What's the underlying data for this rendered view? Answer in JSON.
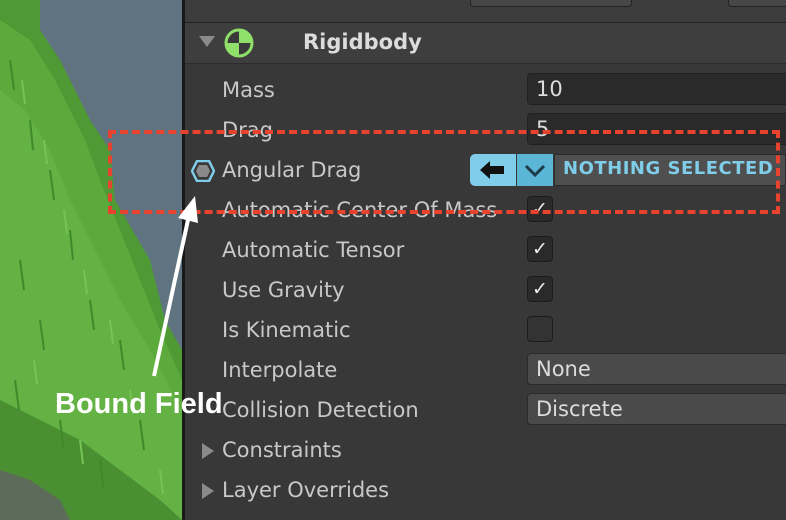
{
  "component": {
    "title": "Rigidbody",
    "icon": "rigidbody-icon"
  },
  "fields": {
    "mass": {
      "label": "Mass",
      "value": "10"
    },
    "drag": {
      "label": "Drag",
      "value": "5"
    },
    "angular_drag": {
      "label": "Angular Drag",
      "binding_value": "NOTHING SELECTED"
    },
    "automatic_center_of_mass": {
      "label": "Automatic Center Of Mass",
      "checked": true
    },
    "automatic_tensor": {
      "label": "Automatic Tensor",
      "checked": true
    },
    "use_gravity": {
      "label": "Use Gravity",
      "checked": true
    },
    "is_kinematic": {
      "label": "Is Kinematic",
      "checked": false
    },
    "interpolate": {
      "label": "Interpolate",
      "value": "None"
    },
    "collision_detection": {
      "label": "Collision Detection",
      "value": "Discrete"
    },
    "constraints": {
      "label": "Constraints"
    },
    "layer_overrides": {
      "label": "Layer Overrides"
    }
  },
  "annotation": {
    "callout_text": "Bound Field",
    "highlight_color": "#e8432f"
  },
  "colors": {
    "binding_accent": "#7fcde8",
    "panel_bg": "#383838",
    "grass": "#5aa13a"
  },
  "check_glyph": "✓"
}
